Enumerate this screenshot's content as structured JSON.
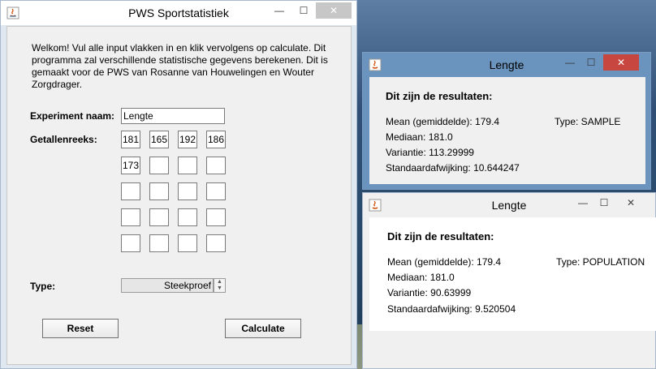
{
  "main_window": {
    "title": "PWS Sportstatistiek",
    "controls": {
      "minimize": "—",
      "maximize": "☐",
      "close": "✕"
    },
    "welcome_text": "Welkom! Vul alle input vlakken in en klik vervolgens op calculate. Dit programma zal verschillende statistische gegevens berekenen. Dit is gemaakt voor de PWS van Rosanne van Houwelingen en Wouter Zorgdrager.",
    "experiment_label": "Experiment naam:",
    "experiment_value": "Lengte",
    "series_label": "Getallenreeks:",
    "series_values": [
      "181",
      "165",
      "192",
      "186",
      "173",
      "",
      "",
      "",
      "",
      "",
      "",
      "",
      "",
      "",
      "",
      "",
      "",
      "",
      "",
      ""
    ],
    "type_label": "Type:",
    "type_value": "Steekproef",
    "reset_label": "Reset",
    "calculate_label": "Calculate"
  },
  "result_sample": {
    "title": "Lengte",
    "heading": "Dit zijn de resultaten:",
    "mean": "Mean (gemiddelde): 179.4",
    "median": "Mediaan: 181.0",
    "variance": "Variantie: 113.29999",
    "stddev": "Standaardafwijking: 10.644247",
    "type": "Type: SAMPLE"
  },
  "result_population": {
    "title": "Lengte",
    "heading": "Dit zijn de resultaten:",
    "mean": "Mean (gemiddelde): 179.4",
    "median": "Mediaan: 181.0",
    "variance": "Variantie: 90.63999",
    "stddev": "Standaardafwijking: 9.520504",
    "type": "Type: POPULATION"
  },
  "colors": {
    "close_active": "#c7463f",
    "title_active": "#6a94bd"
  }
}
